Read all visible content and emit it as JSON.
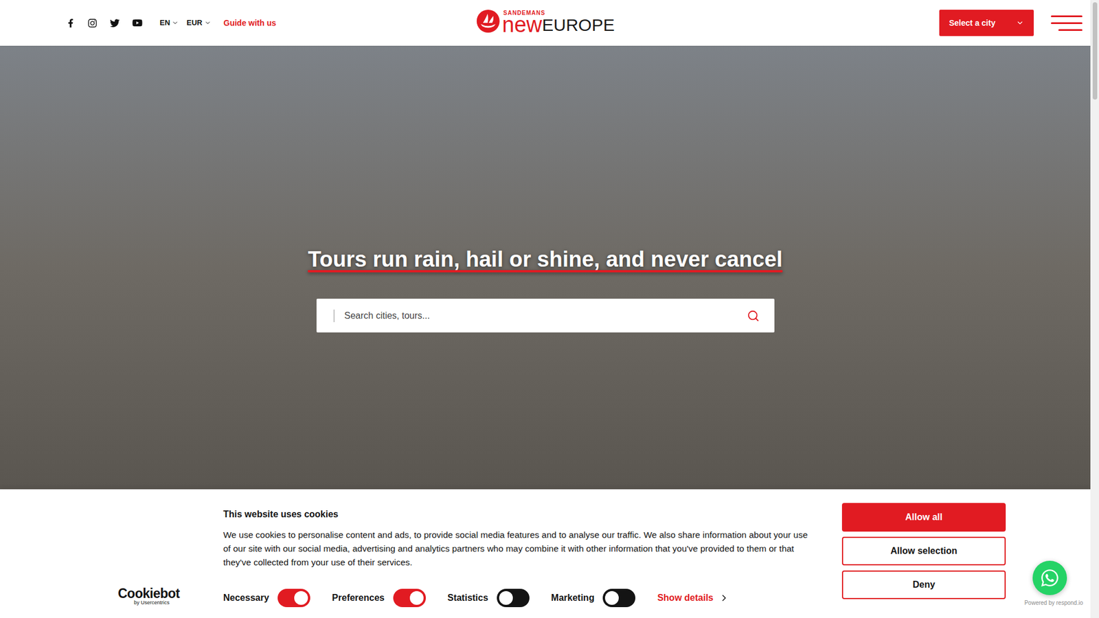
{
  "header": {
    "language": "EN",
    "currency": "EUR",
    "guide_link": "Guide with us",
    "logo": {
      "top": "SANDEMANS",
      "new": "new",
      "europe": "EUROPE"
    },
    "city_select": "Select a city"
  },
  "hero": {
    "heading": "Tours run rain, hail or shine, and never cancel",
    "search": {
      "placeholder": "Search cities, tours..."
    }
  },
  "cookie_banner": {
    "logo": {
      "name": "Cookiebot",
      "sub": "by Usercentrics"
    },
    "title": "This website uses cookies",
    "text": "We use cookies to personalise content and ads, to provide social media features and to analyse our traffic. We also share information about your use of our site with our social media, advertising and analytics partners who may combine it with other information that you've provided to them or that they've collected from your use of their services.",
    "toggles": [
      {
        "label": "Necessary",
        "checked": true
      },
      {
        "label": "Preferences",
        "checked": true
      },
      {
        "label": "Statistics",
        "checked": false
      },
      {
        "label": "Marketing",
        "checked": false
      }
    ],
    "show_details": "Show details",
    "buttons": [
      {
        "label": "Allow all",
        "primary": true
      },
      {
        "label": "Allow selection",
        "primary": false
      },
      {
        "label": "Deny",
        "primary": false
      }
    ]
  },
  "chat_widget": {
    "powered_by": "Powered by respond.io"
  }
}
